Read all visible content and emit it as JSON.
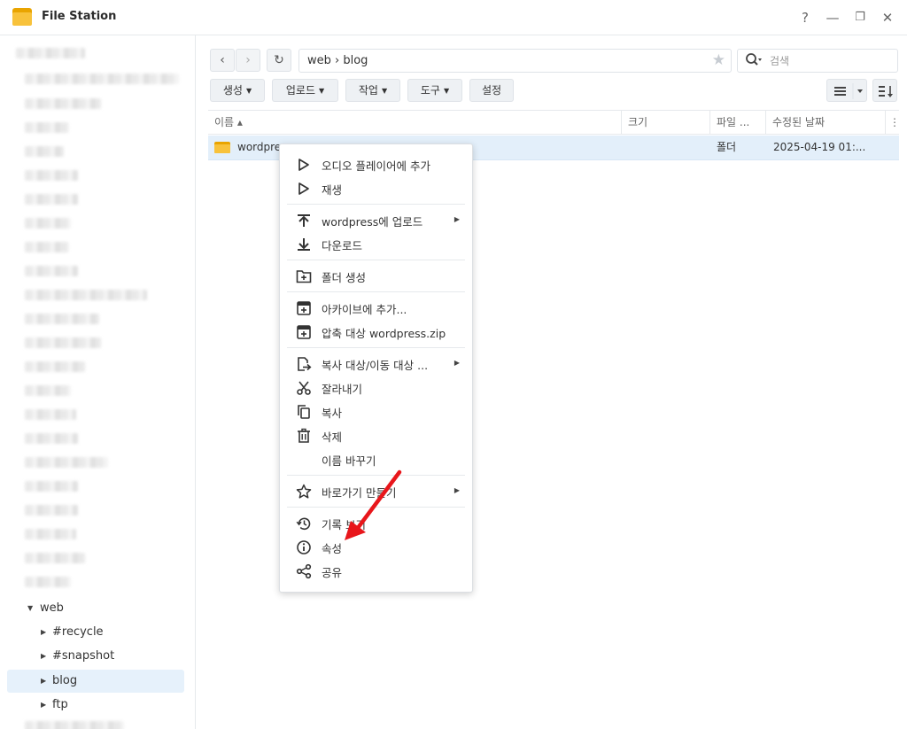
{
  "window": {
    "title": "File Station",
    "help": "?",
    "minimize": "—",
    "restore": "❐",
    "close": "✕"
  },
  "sidebar": {
    "tree": [
      {
        "label": "web",
        "expanded": true
      },
      {
        "label": "#recycle"
      },
      {
        "label": "#snapshot"
      },
      {
        "label": "blog",
        "selected": true
      },
      {
        "label": "ftp"
      }
    ]
  },
  "toolbar": {
    "back": "‹",
    "forward": "›",
    "refresh": "↻",
    "path": "web › blog",
    "search_placeholder": "검색",
    "buttons": [
      "생성",
      "업로드",
      "작업",
      "도구",
      "설정"
    ]
  },
  "table": {
    "columns": [
      "이름 ▴",
      "크기",
      "파일 ...",
      "수정된 날짜"
    ],
    "rows": [
      {
        "name": "wordpress",
        "size": "",
        "type": "폴더",
        "modified": "2025-04-19 01:..."
      }
    ]
  },
  "context_menu": {
    "items": [
      {
        "label": "오디오 플레이어에 추가",
        "icon": "play-icon"
      },
      {
        "label": "재생",
        "icon": "play-icon"
      },
      {
        "label": "wordpress에 업로드",
        "icon": "upload-icon",
        "submenu": true
      },
      {
        "label": "다운로드",
        "icon": "download-icon"
      },
      {
        "label": "폴더 생성",
        "icon": "new-folder-icon"
      },
      {
        "label": "아카이브에 추가...",
        "icon": "archive-icon"
      },
      {
        "label": "압축 대상 wordpress.zip",
        "icon": "archive-icon"
      },
      {
        "label": "복사 대상/이동 대상 ...",
        "icon": "copy-move-icon",
        "submenu": true
      },
      {
        "label": "잘라내기",
        "icon": "scissors-icon"
      },
      {
        "label": "복사",
        "icon": "copy-icon"
      },
      {
        "label": "삭제",
        "icon": "trash-icon"
      },
      {
        "label": "이름 바꾸기",
        "icon": ""
      },
      {
        "label": "바로가기 만들기",
        "icon": "star-icon",
        "submenu": true
      },
      {
        "label": "기록 보기",
        "icon": "history-icon"
      },
      {
        "label": "속성",
        "icon": "info-icon"
      },
      {
        "label": "공유",
        "icon": "share-icon"
      }
    ]
  },
  "colors": {
    "accent": "#e3effa",
    "selected_tree": "#e6f1fb",
    "annotation_arrow": "#e8161b",
    "folder": "#f8c23b"
  }
}
